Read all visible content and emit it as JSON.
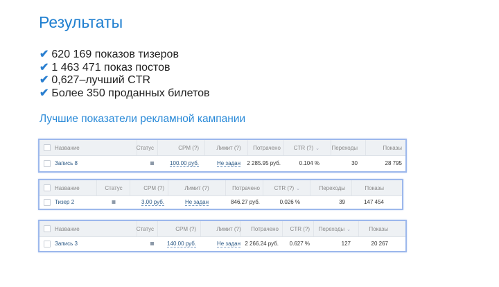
{
  "title": "Результаты",
  "bullets": [
    "620 169 показов тизеров",
    "1 463 471 показ постов",
    "0,627–лучший CTR",
    "Более 350 проданных билетов"
  ],
  "bullet_icon": "checkmark-icon",
  "subtitle": "Лучшие показатели рекламной кампании",
  "colors": {
    "accent": "#1f7fd0",
    "table_border": "#9db8ec",
    "link": "#2a5885"
  },
  "tables": [
    {
      "headers": [
        "Название",
        "Статус",
        "CPM (?)",
        "Лимит (?)",
        "Потрачено",
        "CTR (?)",
        "Переходы",
        "Показы"
      ],
      "sorted_column": "CTR (?)",
      "row": {
        "name": "Запись 8",
        "cpm": "100.00 руб.",
        "limit": "Не задан",
        "spent": "2 285.95 руб.",
        "ctr": "0.104 %",
        "clicks": "30",
        "views": "28 795"
      }
    },
    {
      "headers": [
        "Название",
        "Статус",
        "CPM (?)",
        "Лимит (?)",
        "Потрачено",
        "CTR (?)",
        "Переходы",
        "Показы"
      ],
      "sorted_column": "CTR (?)",
      "row": {
        "name": "Тизер 2",
        "cpm": "3.00 руб.",
        "limit": "Не задан",
        "spent": "846.27 руб.",
        "ctr": "0.026 %",
        "clicks": "39",
        "views": "147 454"
      }
    },
    {
      "headers": [
        "Название",
        "Статус",
        "CPM (?)",
        "Лимит (?)",
        "Потрачено",
        "CTR (?)",
        "Переходы",
        "Показы"
      ],
      "sorted_column": "Переходы",
      "row": {
        "name": "Запись 3",
        "cpm": "140.00 руб.",
        "limit": "Не задан",
        "spent": "2 266.24 руб.",
        "ctr": "0.627 %",
        "clicks": "127",
        "views": "20 267"
      }
    }
  ]
}
